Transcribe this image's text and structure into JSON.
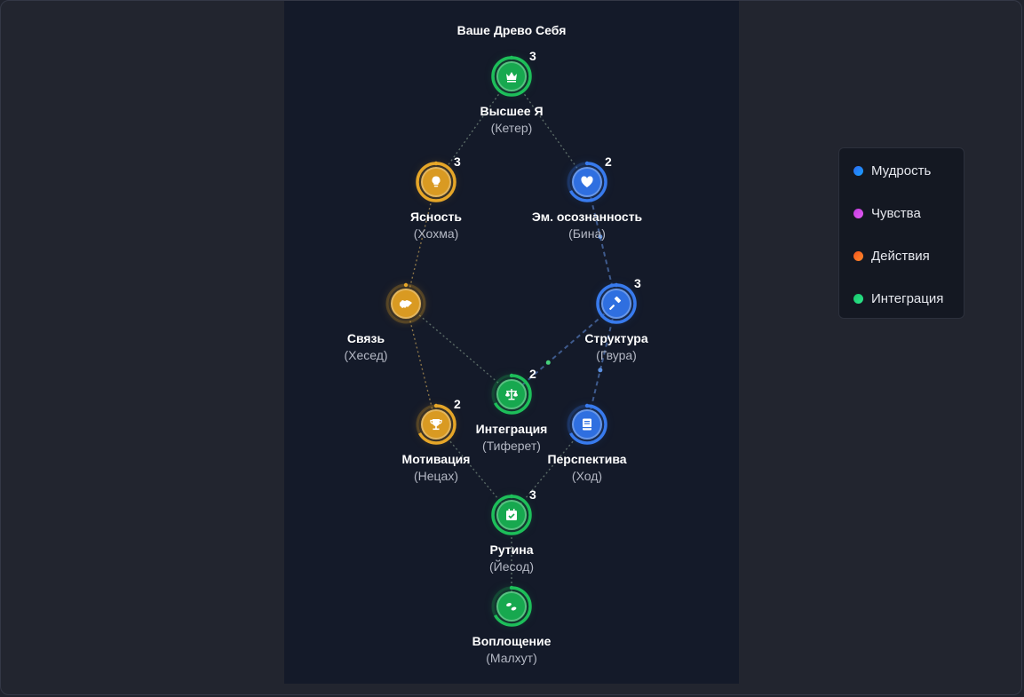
{
  "title": "Ваше Древо Себя",
  "colors": {
    "green": "#17a84f",
    "gold": "#d99a22",
    "blue": "#2f6fe0",
    "panel": "#141a29"
  },
  "nodes": [
    {
      "id": "keter",
      "label": "Высшее Я",
      "sub": "(Кетер)",
      "count": "3",
      "icon": "crown-icon",
      "color": "green",
      "level": 1.0
    },
    {
      "id": "chokhmah",
      "label": "Ясность",
      "sub": "(Хохма)",
      "count": "3",
      "icon": "lightbulb-icon",
      "color": "gold",
      "level": 1.0
    },
    {
      "id": "binah",
      "label": "Эм. осознанность",
      "sub": "(Бина)",
      "count": "2",
      "icon": "heart-icon",
      "color": "blue",
      "level": 0.67
    },
    {
      "id": "chesed",
      "label": "Связь",
      "sub": "(Хесед)",
      "count": "",
      "icon": "handshake-icon",
      "color": "gold",
      "level": 0.0
    },
    {
      "id": "gevurah",
      "label": "Структура",
      "sub": "(Гвура)",
      "count": "3",
      "icon": "gavel-icon",
      "color": "blue",
      "level": 1.0
    },
    {
      "id": "tiferet",
      "label": "Интеграция",
      "sub": "(Тиферет)",
      "count": "2",
      "icon": "balance-scale-icon",
      "color": "green",
      "level": 0.67
    },
    {
      "id": "netzach",
      "label": "Мотивация",
      "sub": "(Нецах)",
      "count": "2",
      "icon": "trophy-icon",
      "color": "gold",
      "level": 0.67
    },
    {
      "id": "hod",
      "label": "Перспектива",
      "sub": "(Ход)",
      "count": "",
      "icon": "book-icon",
      "color": "blue",
      "level": 0.67
    },
    {
      "id": "yesod",
      "label": "Рутина",
      "sub": "(Йесод)",
      "count": "3",
      "icon": "calendar-check-icon",
      "color": "green",
      "level": 1.0
    },
    {
      "id": "malkhut",
      "label": "Воплощение",
      "sub": "(Малхут)",
      "count": "",
      "icon": "footprints-icon",
      "color": "green",
      "level": 0.67
    }
  ],
  "links": [
    {
      "from": "keter",
      "to": "chokhmah",
      "color": "green"
    },
    {
      "from": "keter",
      "to": "binah",
      "color": "green"
    },
    {
      "from": "chokhmah",
      "to": "chesed",
      "color": "gold"
    },
    {
      "from": "binah",
      "to": "gevurah",
      "color": "blue"
    },
    {
      "from": "chesed",
      "to": "netzach",
      "color": "gold"
    },
    {
      "from": "chesed",
      "to": "tiferet",
      "color": "green"
    },
    {
      "from": "gevurah",
      "to": "tiferet",
      "color": "blue"
    },
    {
      "from": "gevurah",
      "to": "hod",
      "color": "blue"
    },
    {
      "from": "netzach",
      "to": "yesod",
      "color": "green"
    },
    {
      "from": "hod",
      "to": "yesod",
      "color": "green"
    },
    {
      "from": "yesod",
      "to": "malkhut",
      "color": "green"
    }
  ],
  "legend": [
    {
      "label": "Мудрость",
      "color": "#2e6bf2",
      "color2": "#18a0ff"
    },
    {
      "label": "Чувства",
      "color": "#c43ce0",
      "color2": "#e25cf2"
    },
    {
      "label": "Действия",
      "color": "#f2541e",
      "color2": "#ff8a2a"
    },
    {
      "label": "Интеграция",
      "color": "#16c46a",
      "color2": "#2ee88c"
    }
  ]
}
